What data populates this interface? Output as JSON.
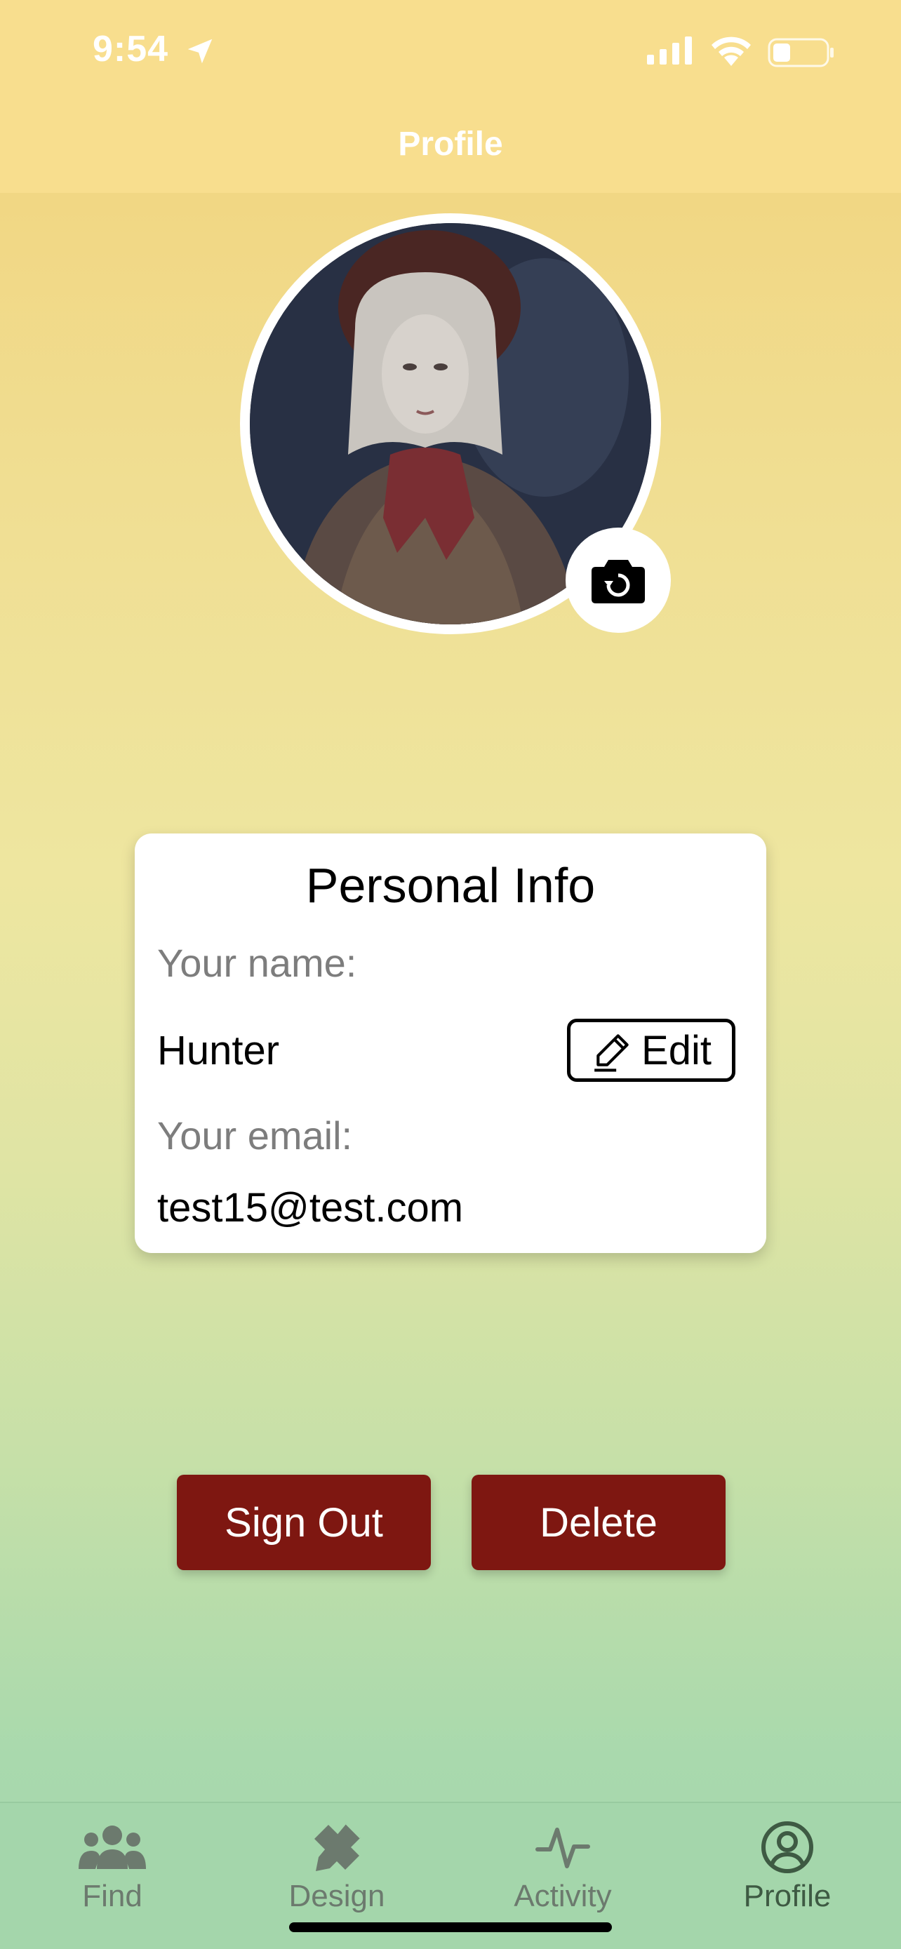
{
  "status_bar": {
    "time": "9:54"
  },
  "header": {
    "title": "Profile"
  },
  "avatar": {
    "description_icon": "profile-photo",
    "camera_icon": "camera-rotate-icon"
  },
  "personal_info": {
    "title": "Personal Info",
    "name_label": "Your name:",
    "name_value": "Hunter",
    "edit_label": "Edit",
    "email_label": "Your email:",
    "email_value": "test15@test.com"
  },
  "actions": {
    "sign_out": "Sign Out",
    "delete": "Delete"
  },
  "tabs": [
    {
      "label": "Find",
      "icon": "people-icon"
    },
    {
      "label": "Design",
      "icon": "pencil-ruler-icon"
    },
    {
      "label": "Activity",
      "icon": "pulse-icon"
    },
    {
      "label": "Profile",
      "icon": "user-circle-icon",
      "active": true
    }
  ],
  "colors": {
    "accent_button": "#7e1711",
    "header_bg": "#f8de8e",
    "tab_bar_bg": "#a4d6ab"
  }
}
